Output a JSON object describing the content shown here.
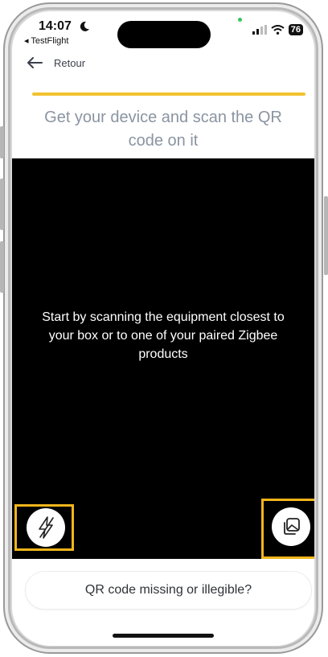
{
  "status_bar": {
    "time": "14:07",
    "back_app": "◂ TestFlight",
    "battery": "76",
    "icons": [
      "moon-icon",
      "cellular-signal-icon",
      "wifi-icon",
      "battery-icon"
    ]
  },
  "nav": {
    "back_label": "Retour",
    "back_icon": "arrow-left-icon"
  },
  "progress": {
    "value": 1.0,
    "color": "#f2c230"
  },
  "instruction": "Get your device and scan the QR code on it",
  "scanner": {
    "overlay_text": "Start by scanning the equipment closest to your box or to one of your paired Zigbee products",
    "flash_icon": "flash-icon",
    "gallery_icon": "gallery-icon"
  },
  "footer": {
    "missing_qr_label": "QR code missing or illegible?"
  },
  "colors": {
    "accent": "#f2c230",
    "highlight": "#f2b51b",
    "camera_bg": "#000000",
    "instruction_text": "#8a94a1"
  }
}
